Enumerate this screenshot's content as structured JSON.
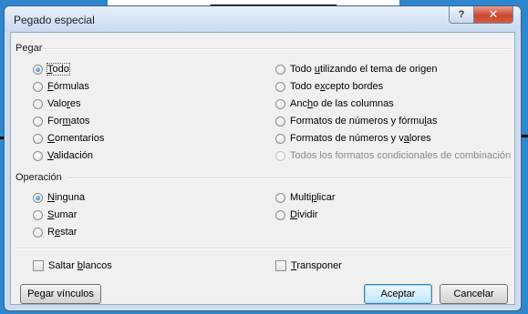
{
  "window": {
    "title": "Pegado especial"
  },
  "titlebar_buttons": {
    "help": "?",
    "close": "✕"
  },
  "paste": {
    "label": "Pegar",
    "options_left": [
      {
        "label": "Todo",
        "checked": true
      },
      {
        "label": "Fórmulas",
        "checked": false
      },
      {
        "label": "Valores",
        "checked": false
      },
      {
        "label": "Formatos",
        "checked": false
      },
      {
        "label": "Comentarios",
        "checked": false
      },
      {
        "label": "Validación",
        "checked": false
      }
    ],
    "options_right": [
      {
        "label": "Todo utilizando el tema de origen",
        "checked": false
      },
      {
        "label": "Todo excepto bordes",
        "checked": false
      },
      {
        "label": "Ancho de las columnas",
        "checked": false
      },
      {
        "label": "Formatos de números y fórmulas",
        "checked": false
      },
      {
        "label": "Formatos de números y valores",
        "checked": false
      },
      {
        "label": "Todos los formatos condicionales de combinación",
        "checked": false,
        "disabled": true
      }
    ]
  },
  "operation": {
    "label": "Operación",
    "options_left": [
      {
        "label": "Ninguna",
        "checked": true
      },
      {
        "label": "Sumar",
        "checked": false
      },
      {
        "label": "Restar",
        "checked": false
      }
    ],
    "options_right": [
      {
        "label": "Multiplicar",
        "checked": false
      },
      {
        "label": "Dividir",
        "checked": false
      }
    ]
  },
  "checkboxes": {
    "skip_blanks": {
      "label": "Saltar blancos",
      "checked": false
    },
    "transpose": {
      "label": "Transponer",
      "checked": false
    }
  },
  "buttons": {
    "paste_link": "Pegar vínculos",
    "ok": "Aceptar",
    "cancel": "Cancelar"
  },
  "colors": {
    "background": "#2e86cf",
    "window_frame": "#c9dcf2",
    "client": "#f0f0f0",
    "close_button": "#c9472f"
  }
}
